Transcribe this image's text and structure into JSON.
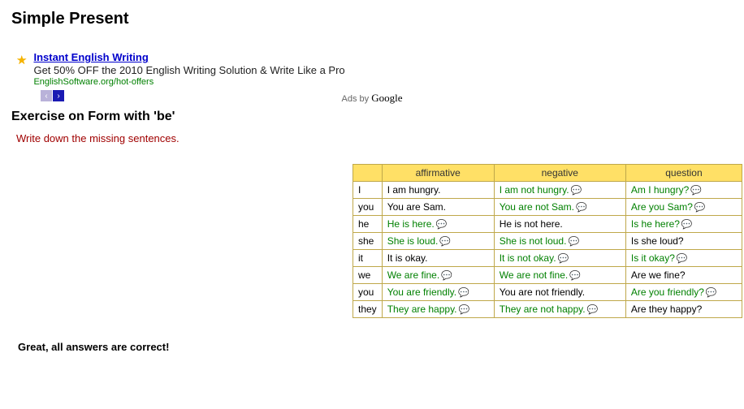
{
  "page": {
    "title": "Simple Present",
    "section_title": "Exercise on Form with 'be'",
    "instruction": "Write down the missing sentences.",
    "feedback": "Great, all answers are correct!"
  },
  "ad": {
    "title": "Instant English Writing",
    "desc": "Get 50% OFF the 2010 English Writing Solution & Write Like a Pro",
    "url": "EnglishSoftware.org/hot-offers",
    "ads_by_prefix": "Ads by ",
    "ads_by_brand": "Google",
    "prev": "‹",
    "next": "›"
  },
  "table": {
    "headers": {
      "corner": "",
      "affirmative": "affirmative",
      "negative": "negative",
      "question": "question"
    },
    "rows": [
      {
        "pronoun": "I",
        "aff": {
          "text": "I am hungry.",
          "type": "given",
          "bubble": false
        },
        "neg": {
          "text": "I am not hungry.",
          "type": "answer",
          "bubble": true
        },
        "q": {
          "text": "Am I hungry?",
          "type": "answer",
          "bubble": true
        }
      },
      {
        "pronoun": "you",
        "aff": {
          "text": "You are Sam.",
          "type": "given",
          "bubble": false
        },
        "neg": {
          "text": "You are not Sam.",
          "type": "answer",
          "bubble": true
        },
        "q": {
          "text": "Are you Sam?",
          "type": "answer",
          "bubble": true
        }
      },
      {
        "pronoun": "he",
        "aff": {
          "text": "He is here.",
          "type": "answer",
          "bubble": true
        },
        "neg": {
          "text": "He is not here.",
          "type": "given",
          "bubble": false
        },
        "q": {
          "text": "Is he here?",
          "type": "answer",
          "bubble": true
        }
      },
      {
        "pronoun": "she",
        "aff": {
          "text": "She is loud.",
          "type": "answer",
          "bubble": true
        },
        "neg": {
          "text": "She is not loud.",
          "type": "answer",
          "bubble": true
        },
        "q": {
          "text": "Is she loud?",
          "type": "given",
          "bubble": false
        }
      },
      {
        "pronoun": "it",
        "aff": {
          "text": "It is okay.",
          "type": "given",
          "bubble": false
        },
        "neg": {
          "text": "It is not okay.",
          "type": "answer",
          "bubble": true
        },
        "q": {
          "text": "Is it okay?",
          "type": "answer",
          "bubble": true
        }
      },
      {
        "pronoun": "we",
        "aff": {
          "text": "We are fine.",
          "type": "answer",
          "bubble": true
        },
        "neg": {
          "text": "We are not fine.",
          "type": "answer",
          "bubble": true
        },
        "q": {
          "text": "Are we fine?",
          "type": "given",
          "bubble": false
        }
      },
      {
        "pronoun": "you",
        "aff": {
          "text": "You are friendly.",
          "type": "answer",
          "bubble": true
        },
        "neg": {
          "text": "You are not friendly.",
          "type": "given",
          "bubble": false
        },
        "q": {
          "text": "Are you friendly?",
          "type": "answer",
          "bubble": true
        }
      },
      {
        "pronoun": "they",
        "aff": {
          "text": "They are happy.",
          "type": "answer",
          "bubble": true
        },
        "neg": {
          "text": "They are not happy.",
          "type": "answer",
          "bubble": true
        },
        "q": {
          "text": "Are they happy?",
          "type": "given",
          "bubble": false
        }
      }
    ]
  },
  "icons": {
    "bubble": "💬"
  }
}
